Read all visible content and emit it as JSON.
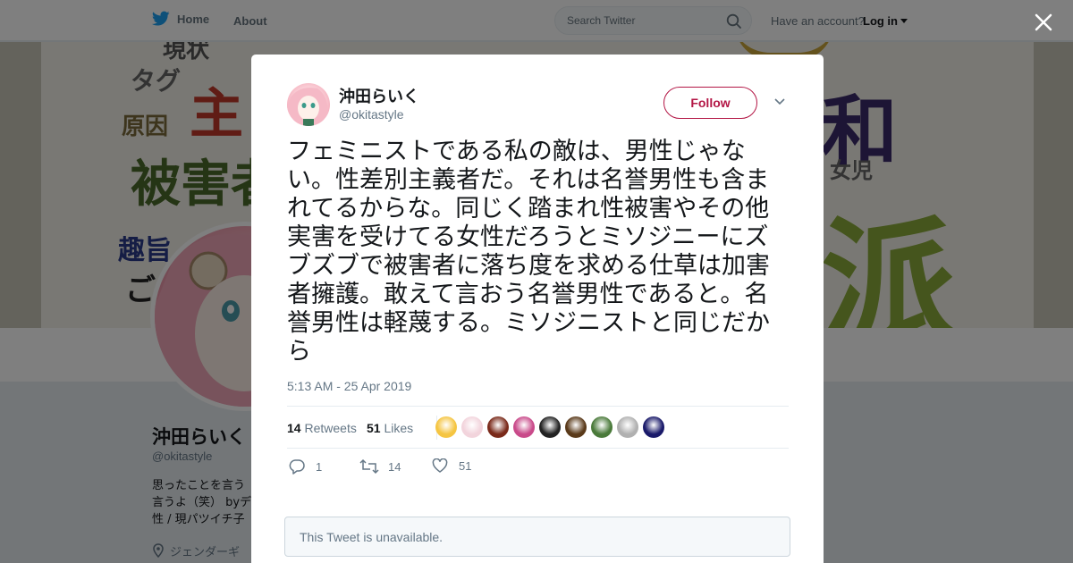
{
  "nav": {
    "home_label": "Home",
    "about_label": "About",
    "search_placeholder": "Search Twitter",
    "account_prompt": "Have an account?",
    "login_label": "Log in"
  },
  "banner_words": [
    "現状",
    "タグ",
    "主",
    "原因",
    "被害者",
    "趣旨",
    "ご",
    "和",
    "女児",
    "派"
  ],
  "profile": {
    "name": "沖田らいく",
    "handle": "@okitastyle",
    "bio": "思ったことを言う\n言うよ（笑） byデ\n性 / 現パツイチ子",
    "location": "ジェンダーギ"
  },
  "tweet": {
    "author_name": "沖田らいく",
    "author_handle": "@okitastyle",
    "follow_label": "Follow",
    "text": "フェミニストである私の敵は、男性じゃない。性差別主義者だ。それは名誉男性も含まれてるからな。同じく踏まれ性被害やその他実害を受けてる女性だろうとミソジニーにズブズブで被害者に落ち度を求める仕草は加害者擁護。敢えて言おう名誉男性であると。名誉男性は軽蔑する。ミソジニストと同じだから",
    "timestamp": "5:13 AM - 25 Apr 2019",
    "retweets_count": "14",
    "retweets_label": "Retweets",
    "likes_count": "51",
    "likes_label": "Likes",
    "reply_count": "1",
    "retweet_action_count": "14",
    "like_action_count": "51",
    "liker_colors": [
      "#f5c542",
      "#f2d4dc",
      "#7a2a1a",
      "#c94a8a",
      "#222222",
      "#5a3a1a",
      "#4a7a3a",
      "#b0b0b0",
      "#1a1a6a"
    ],
    "quoted_unavailable": "This Tweet is unavailable."
  },
  "colors": {
    "accent_follow": "#b31645",
    "twitter_blue": "#1da1f2",
    "overlay": "rgba(0,0,0,0.5)"
  }
}
